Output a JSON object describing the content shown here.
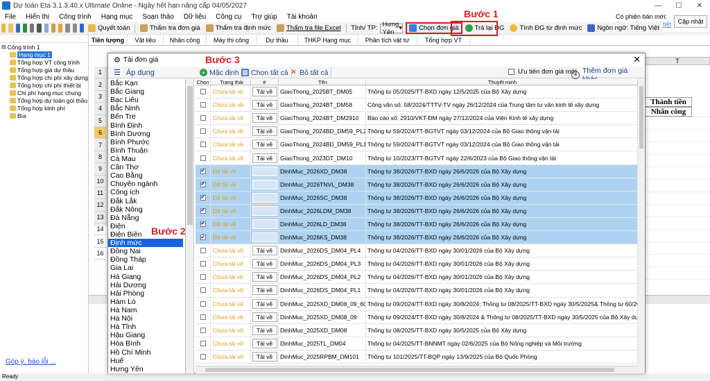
{
  "window": {
    "title": "Dự toán Eta 3.1.3.40.x Ultimate Online  - Ngày hết hạn nâng cấp 04/05/2027",
    "min": "—",
    "max": "☐",
    "close": "✕"
  },
  "menu": [
    "File",
    "Hiển thị",
    "Công trình",
    "Hạng mục",
    "Soạn thảo",
    "Dữ liệu",
    "Công cụ",
    "Trợ giúp",
    "Tài khoản"
  ],
  "toolbar": {
    "quyet_toan": "Quyết toán",
    "tham_tra_don_gia": "Thẩm tra đơn giá",
    "tham_tra_dinh_muc": "Thẩm tra định mức",
    "tham_tra_file_excel": "Thẩm tra file Excel",
    "tinh_tp_label": "Tỉnh/ TP:",
    "tinh_tp_value": "Hưng Yên",
    "chon_don_gia": "Chọn đơn giá",
    "tra_lai_dg": "Trả lại ĐG",
    "tinh_dg_tu_dinh_muc": "Tính ĐG từ định mức",
    "ngon_ngu": "Ngôn ngữ: Tiếng Việt"
  },
  "update_panel": {
    "label": "Có phiên bản mới:",
    "link": "Click để xem chi tiết",
    "button": "Cập nhật"
  },
  "tree": [
    {
      "label": "Công trình 1",
      "level": 0,
      "selected": false
    },
    {
      "label": "Hạng mục 1",
      "level": 1,
      "selected": true
    },
    {
      "label": "Tổng hợp VT công trình",
      "level": 1,
      "selected": false
    },
    {
      "label": "Tổng hợp giá dự thầu",
      "level": 1,
      "selected": false
    },
    {
      "label": "Tổng hợp chi phí xây dựng",
      "level": 1,
      "selected": false
    },
    {
      "label": "Tổng hợp chi phí thiết bị",
      "level": 1,
      "selected": false
    },
    {
      "label": "Chi phí hạng mục chung",
      "level": 1,
      "selected": false
    },
    {
      "label": "Tổng hợp dự toán gói thầu",
      "level": 1,
      "selected": false
    },
    {
      "label": "Tổng hợp kinh phí",
      "level": 1,
      "selected": false
    },
    {
      "label": "Bìa",
      "level": 1,
      "selected": false
    }
  ],
  "feedback_link": "Góp ý, báo lỗi ...",
  "tabs": [
    "Tiên lượng",
    "Vật liệu",
    "Nhân công",
    "Máy thi công",
    "Dự thầu",
    "THKP Hạng mục",
    "Phân tích vật tư",
    "Tổng hợp VT"
  ],
  "background_sheet": {
    "col_t": "T",
    "thanh_tien": "Thành tiền",
    "nhan_cong": "Nhân công",
    "row_numbers": [
      "1",
      "2",
      "3",
      "4",
      "5",
      "6",
      "7",
      "8",
      "9",
      "10",
      "11",
      "12",
      "13",
      "14",
      "15",
      "16"
    ],
    "highlight_row": "6",
    "status": "Ready"
  },
  "dialog": {
    "title": "Tải đơn giá",
    "apply": "Áp dụng",
    "mac_dinh": "Mặc định",
    "chon_tat_ca": "Chọn tất cả",
    "bo_tat_ca": "Bỏ tất cả",
    "uu_tien": "Ưu tiên đơn giá mới",
    "them_don_gia_khac": "Thêm đơn giá khác",
    "provinces": [
      "Bắc Kạn",
      "Bắc Giang",
      "Bạc Liêu",
      "Bắc Ninh",
      "Bến Tre",
      "Bình Định",
      "Bình Dương",
      "Bình Phước",
      "Bình Thuận",
      "Cà Mau",
      "Cần Thơ",
      "Cao Bằng",
      "Chuyên ngành",
      "Công ích",
      "Đắk Lắk",
      "Đắk Nông",
      "Đà Nẵng",
      "Điện",
      "Điện Biên",
      "Định mức",
      "Đồng Nai",
      "Đồng Tháp",
      "Gia Lai",
      "Hà Giang",
      "Hải Dương",
      "Hải Phòng",
      "Hàm Lò",
      "Hà Nam",
      "Hà Nội",
      "Hà Tĩnh",
      "Hậu Giang",
      "Hòa Bình",
      "Hồ Chí Minh",
      "Huế",
      "Hưng Yên"
    ],
    "selected_province": "Định mức",
    "columns": {
      "chon": "Chọn",
      "trang_thai": "Trạng thái",
      "hash": "#",
      "ten": "Tên",
      "thuyet_minh": "Thuyết minh"
    },
    "rows": [
      {
        "checked": false,
        "status": "Chưa tải về",
        "action": "Tải về",
        "name": "GiaoThong_2025BT_DM05",
        "desc": "Thông tư 05/2025/TT-BXD ngày 12/5/2025 của Bộ Xây dựng",
        "selected": false
      },
      {
        "checked": false,
        "status": "Chưa tải về",
        "action": "Tải về",
        "name": "GiaoThong_2024BT_DM58",
        "desc": "Công văn số: 58/2024/TTTV-TV ngày 26/12/2024 của Trung tâm tư vấn kinh tế xây dựng",
        "selected": false
      },
      {
        "checked": false,
        "status": "Chưa tải về",
        "action": "Tải về",
        "name": "GiaoThong_2024BT_DM2910",
        "desc": "Báo cáo số: 2910/VKT-ĐM ngày 27/12/2024 của Viện Kinh tế xây dựng",
        "selected": false
      },
      {
        "checked": false,
        "status": "Chưa tải về",
        "action": "Tải về",
        "name": "GiaoThong_2024BD_DM59_PL2",
        "desc": "Thông tư 59/2024/TT-BGTVT ngày 03/12/2024 của Bộ Giao thông vận tải",
        "selected": false
      },
      {
        "checked": false,
        "status": "Chưa tải về",
        "action": "Tải về",
        "name": "GiaoThong_2024BD_DM59_PL1",
        "desc": "Thông tư 59/2024/TT-BGTVT ngày 03/12/2024 của Bộ Giao thông vận tải",
        "selected": false
      },
      {
        "checked": false,
        "status": "Chưa tải về",
        "action": "Tải về",
        "name": "GiaoThong_2023DT_DM10",
        "desc": "Thông tư 10/2023/TT-BGTVT ngày 22/6/2023 của Bộ Giao thông vận tải",
        "selected": false
      },
      {
        "checked": true,
        "status": "Đã tải về",
        "action": "",
        "name": "DinhMuc_2026XD_DM38",
        "desc": "Thông tư 38/2026/TT-BXD ngày 26/6/2026 của Bộ Xây dựng",
        "selected": true
      },
      {
        "checked": true,
        "status": "Đã tải về",
        "action": "",
        "name": "DinhMuc_2026TNVL_DM38",
        "desc": "Thông tư 38/2026/TT-BXD ngày 26/6/2026 của Bộ Xây dựng",
        "selected": true
      },
      {
        "checked": true,
        "status": "Đã tải về",
        "action": "",
        "name": "DinhMuc_2026SC_DM38",
        "desc": "Thông tư 38/2026/TT-BXD ngày 26/6/2026 của Bộ Xây dựng",
        "selected": true
      },
      {
        "checked": true,
        "status": "Đã tải về",
        "action": "",
        "name": "DinhMuc_2026LDM_DM38",
        "desc": "Thông tư 38/2026/TT-BXD ngày 26/6/2026 của Bộ Xây dựng",
        "selected": true
      },
      {
        "checked": true,
        "status": "Đã tải về",
        "action": "",
        "name": "DinhMuc_2026LD_DM38",
        "desc": "Thông tư 38/2026/TT-BXD ngày 26/6/2026 của Bộ Xây dựng",
        "selected": true
      },
      {
        "checked": true,
        "status": "Đã tải về",
        "action": "",
        "name": "DinhMuc_2026KS_DM38",
        "desc": "Thông tư 38/2026/TT-BXD ngày 26/6/2026 của Bộ Xây dựng",
        "selected": true
      },
      {
        "checked": false,
        "status": "Chưa tải về",
        "action": "Tải về",
        "name": "DinhMuc_2026DS_DM04_PL4",
        "desc": "Thông tư 04/2026/TT-BXD ngày 30/01/2026 của Bộ Xây dựng",
        "selected": false
      },
      {
        "checked": false,
        "status": "Chưa tải về",
        "action": "Tải về",
        "name": "DinhMuc_2026DS_DM04_PL3",
        "desc": "Thông tư 04/2026/TT-BXD ngày 30/01/2026 của Bộ Xây dựng",
        "selected": false
      },
      {
        "checked": false,
        "status": "Chưa tải về",
        "action": "Tải về",
        "name": "DinhMuc_2026DS_DM04_PL2",
        "desc": "Thông tư 04/2026/TT-BXD ngày 30/01/2026 của Bộ Xây dựng",
        "selected": false
      },
      {
        "checked": false,
        "status": "Chưa tải về",
        "action": "Tải về",
        "name": "DinhMuc_2026DS_DM04_PL1",
        "desc": "Thông tư 04/2026/TT-BXD ngày 30/01/2026 của Bộ Xây dựng",
        "selected": false
      },
      {
        "checked": false,
        "status": "Chưa tải về",
        "action": "Tải về",
        "name": "DinhMuc_2025XD_DM08_09_60",
        "desc": "Thông tư 09/2024/TT-BXD ngày 30/8/2024; Thông tư 08/2025/TT-BXD ngày 30/5/2025& Thông tư 60/2025/TT-BXD ngày",
        "selected": false
      },
      {
        "checked": false,
        "status": "Chưa tải về",
        "action": "Tải về",
        "name": "DinhMuc_2025XD_DM08_09",
        "desc": "Thông tư 09/2024/TT-BXD ngày 30/8/2024 & Thông tư 08/2025/TT-BXD ngày 30/5/2025 của Bộ Xây dựng",
        "selected": false
      },
      {
        "checked": false,
        "status": "Chưa tải về",
        "action": "Tải về",
        "name": "DinhMuc_2025XD_DM08",
        "desc": "Thông tư 08/2025/TT-BXD ngày 30/5/2025 của Bộ Xây dựng",
        "selected": false
      },
      {
        "checked": false,
        "status": "Chưa tải về",
        "action": "Tải về",
        "name": "DinhMuc_2025TL_DM04",
        "desc": "Thông tư 04/2025/TT-BNNMT ngày 02/6/2025 của Bộ Nông nghiệp và Môi trường",
        "selected": false
      },
      {
        "checked": false,
        "status": "Chưa tải về",
        "action": "Tải về",
        "name": "DinhMuc_2025RPBM_DM101",
        "desc": "Thông tư 101/2025/TT-BQP ngày 13/9/2025 của Bộ Quốc Phòng",
        "selected": false
      }
    ]
  },
  "annotations": {
    "step1": "Bước 1",
    "step2": "Bước 2",
    "step3": "Bước 3"
  },
  "colors": {
    "annotation_red": "#d62020",
    "selection_blue": "#1963d8",
    "row_selected": "#aed3f2",
    "status_orange": "#e39c1a"
  }
}
